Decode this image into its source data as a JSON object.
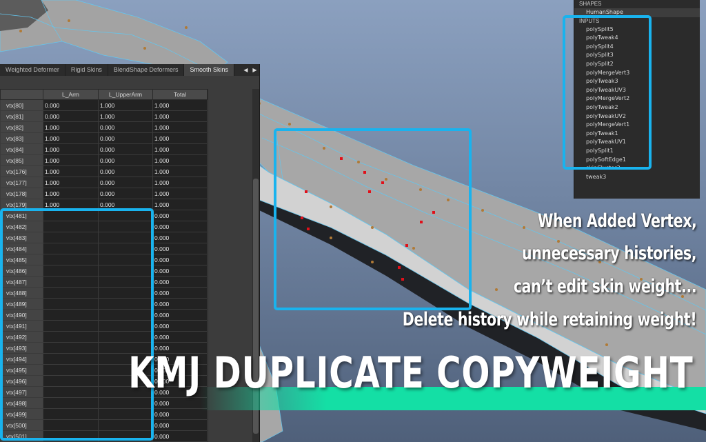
{
  "editor": {
    "tabs": [
      "Weighted Deformer",
      "Rigid Skins",
      "BlendShape Deformers",
      "Smooth Skins"
    ],
    "active_tab": "Smooth Skins",
    "tab_arrows": [
      "◀",
      "▶"
    ],
    "columns": [
      "",
      "L_Arm",
      "L_UpperArm",
      "Total"
    ],
    "rows": [
      [
        "vtx[80]",
        "0.000",
        "1.000",
        "1.000"
      ],
      [
        "vtx[81]",
        "0.000",
        "1.000",
        "1.000"
      ],
      [
        "vtx[82]",
        "1.000",
        "0.000",
        "1.000"
      ],
      [
        "vtx[83]",
        "1.000",
        "0.000",
        "1.000"
      ],
      [
        "vtx[84]",
        "1.000",
        "0.000",
        "1.000"
      ],
      [
        "vtx[85]",
        "1.000",
        "0.000",
        "1.000"
      ],
      [
        "vtx[176]",
        "1.000",
        "0.000",
        "1.000"
      ],
      [
        "vtx[177]",
        "1.000",
        "0.000",
        "1.000"
      ],
      [
        "vtx[178]",
        "1.000",
        "0.000",
        "1.000"
      ],
      [
        "vtx[179]",
        "1.000",
        "0.000",
        "1.000"
      ],
      [
        "vtx[481]",
        "",
        "",
        "0.000"
      ],
      [
        "vtx[482]",
        "",
        "",
        "0.000"
      ],
      [
        "vtx[483]",
        "",
        "",
        "0.000"
      ],
      [
        "vtx[484]",
        "",
        "",
        "0.000"
      ],
      [
        "vtx[485]",
        "",
        "",
        "0.000"
      ],
      [
        "vtx[486]",
        "",
        "",
        "0.000"
      ],
      [
        "vtx[487]",
        "",
        "",
        "0.000"
      ],
      [
        "vtx[488]",
        "",
        "",
        "0.000"
      ],
      [
        "vtx[489]",
        "",
        "",
        "0.000"
      ],
      [
        "vtx[490]",
        "",
        "",
        "0.000"
      ],
      [
        "vtx[491]",
        "",
        "",
        "0.000"
      ],
      [
        "vtx[492]",
        "",
        "",
        "0.000"
      ],
      [
        "vtx[493]",
        "",
        "",
        "0.000"
      ],
      [
        "vtx[494]",
        "",
        "",
        "0.000"
      ],
      [
        "vtx[495]",
        "",
        "",
        "0.000"
      ],
      [
        "vtx[496]",
        "",
        "",
        "0.000"
      ],
      [
        "vtx[497]",
        "",
        "",
        "0.000"
      ],
      [
        "vtx[498]",
        "",
        "",
        "0.000"
      ],
      [
        "vtx[499]",
        "",
        "",
        "0.000"
      ],
      [
        "vtx[500]",
        "",
        "",
        "0.000"
      ],
      [
        "vtx[501]",
        "",
        "",
        "0.000"
      ]
    ]
  },
  "outliner": {
    "shapes_header": "SHAPES",
    "shape_node": "HumanShape",
    "inputs_header": "INPUTS",
    "inputs": [
      "polySplit5",
      "polyTweak4",
      "polySplit4",
      "polySplit3",
      "polySplit2",
      "polyMergeVert3",
      "polyTweak3",
      "polyTweakUV3",
      "polyMergeVert2",
      "polyTweak2",
      "polyTweakUV2",
      "polyMergeVert1",
      "polyTweak1",
      "polyTweakUV1",
      "polySplit1",
      "polySoftEdge1",
      "skinCluster3",
      "tweak3"
    ]
  },
  "captions": [
    "When Added Vertex,",
    "unnecessary histories,",
    "can’t edit skin weight...",
    "Delete history while retaining weight!"
  ],
  "title": "KMJ DUPLICATE COPYWEIGHT",
  "colors": {
    "highlight": "#19b3ee",
    "banner": "#14dfa5",
    "selected_vertex": "#e0101a"
  }
}
